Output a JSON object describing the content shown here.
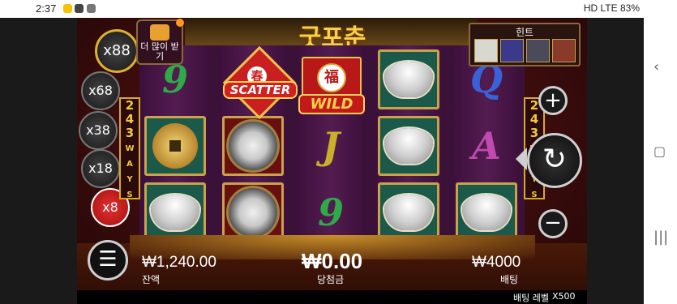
{
  "status_bar": {
    "time": "2:37",
    "right_indicators": "HD LTE 83%"
  },
  "game": {
    "title": "굿포춘",
    "more_button_label": "더 많이 받기",
    "hint_label": "힌트",
    "ways_label": "243 WAYS",
    "multipliers": [
      {
        "label": "x88",
        "active": false
      },
      {
        "label": "x68",
        "active": false
      },
      {
        "label": "x38",
        "active": false
      },
      {
        "label": "x18",
        "active": false
      },
      {
        "label": "x8",
        "active": true
      }
    ],
    "symbols": {
      "scatter": "SCATTER",
      "scatter_char": "春",
      "wild": "WILD",
      "wild_char": "福",
      "nine": "9",
      "q": "Q",
      "j": "J",
      "a": "A"
    },
    "balance": {
      "value": "₩1,240.00",
      "label": "잔액"
    },
    "win": {
      "value": "₩0.00",
      "label": "당첨금"
    },
    "bet": {
      "value": "₩4000",
      "label": "배팅"
    },
    "bet_level": {
      "label": "배팅 레벨",
      "value": "X500"
    },
    "buttons": {
      "spin": "↻",
      "plus": "+",
      "minus": "−",
      "menu": "☰"
    }
  }
}
